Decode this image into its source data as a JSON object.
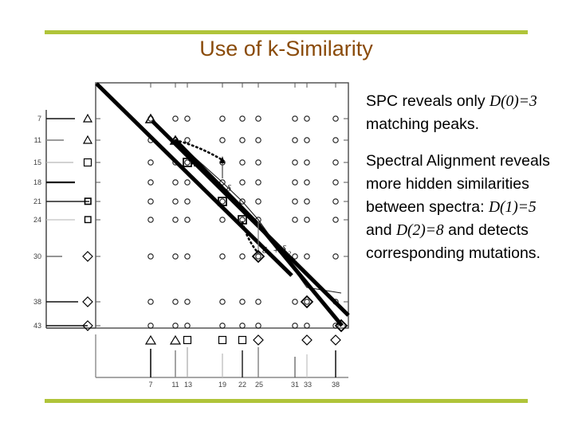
{
  "slide": {
    "title": "Use of k-Similarity",
    "accent_color": "#b0c43a",
    "title_color": "#8a4b0a",
    "background": "#ffffff"
  },
  "body_text": {
    "paragraphs": [
      {
        "id": "spc-paragraph",
        "runs": [
          {
            "text": "SPC reveals only ",
            "style": "normal"
          },
          {
            "text": "D(0)=3",
            "style": "italic"
          },
          {
            "text": " matching peaks.",
            "style": "normal"
          }
        ]
      },
      {
        "id": "spectral-alignment-paragraph",
        "runs": [
          {
            "text": "Spectral Alignment reveals more hidden similarities between spectra: ",
            "style": "normal"
          },
          {
            "text": "D(1)=5",
            "style": "italic"
          },
          {
            "text": " and ",
            "style": "normal"
          },
          {
            "text": "D(2)=8",
            "style": "italic"
          },
          {
            "text": " and detects corresponding mutations.",
            "style": "normal"
          }
        ]
      }
    ]
  },
  "chart_data": {
    "type": "scatter",
    "title": "",
    "xlabel": "",
    "ylabel": "",
    "description": "Spectral alignment dot-plot (spectral product grid) of two spectra with three diagonals: main diagonal, a shifted diagonal and a twice-shifted diagonal.",
    "grid": false,
    "x_ticks": [
      7,
      11,
      13,
      19,
      22,
      25,
      31,
      33,
      38
    ],
    "y_ticks": [
      7,
      11,
      15,
      18,
      21,
      24,
      30,
      38,
      43
    ],
    "x_tick_labels": [
      "7",
      "11",
      "13",
      "19",
      "22",
      "25",
      "31",
      "33",
      "38"
    ],
    "y_tick_labels": [
      "7",
      "11",
      "15",
      "18",
      "21",
      "24",
      "30",
      "38",
      "43"
    ],
    "xlim": [
      0,
      45
    ],
    "ylim": [
      0,
      48
    ],
    "bottom_spectrum_markers": [
      {
        "x": 7,
        "shape": "triangle"
      },
      {
        "x": 11,
        "shape": "triangle"
      },
      {
        "x": 13,
        "shape": "square"
      },
      {
        "x": 19,
        "shape": "square"
      },
      {
        "x": 22,
        "shape": "square"
      },
      {
        "x": 25,
        "shape": "diamond"
      },
      {
        "x": 33,
        "shape": "diamond"
      },
      {
        "x": 38,
        "shape": "diamond"
      }
    ],
    "left_spectrum_markers": [
      {
        "y": 7,
        "shape": "triangle"
      },
      {
        "y": 11,
        "shape": "triangle"
      },
      {
        "y": 15,
        "shape": "square"
      },
      {
        "y": 21,
        "shape": "square"
      },
      {
        "y": 24,
        "shape": "square"
      },
      {
        "y": 30,
        "shape": "diamond"
      },
      {
        "y": 38,
        "shape": "diamond"
      },
      {
        "y": 43,
        "shape": "diamond"
      }
    ],
    "matched_points_d0": [
      {
        "x": 7,
        "y": 7,
        "shape": "triangle"
      },
      {
        "x": 11,
        "y": 11,
        "shape": "triangle"
      },
      {
        "x": 13,
        "y": 15,
        "shape": "square"
      }
    ],
    "matched_points_d1": [
      {
        "x": 19,
        "y": 21,
        "shape": "square"
      },
      {
        "x": 22,
        "y": 24,
        "shape": "square"
      }
    ],
    "matched_points_d2": [
      {
        "x": 25,
        "y": 30,
        "shape": "diamond"
      },
      {
        "x": 33,
        "y": 38,
        "shape": "diamond"
      },
      {
        "x": 38,
        "y": 43,
        "shape": "diamond"
      }
    ],
    "annotations": [
      {
        "text": "δ",
        "x": 19,
        "y": 17,
        "kind": "shift-1"
      },
      {
        "text": "δ1 + δ2",
        "x": 26,
        "y": 29,
        "kind": "shift-2"
      }
    ],
    "legend": []
  }
}
